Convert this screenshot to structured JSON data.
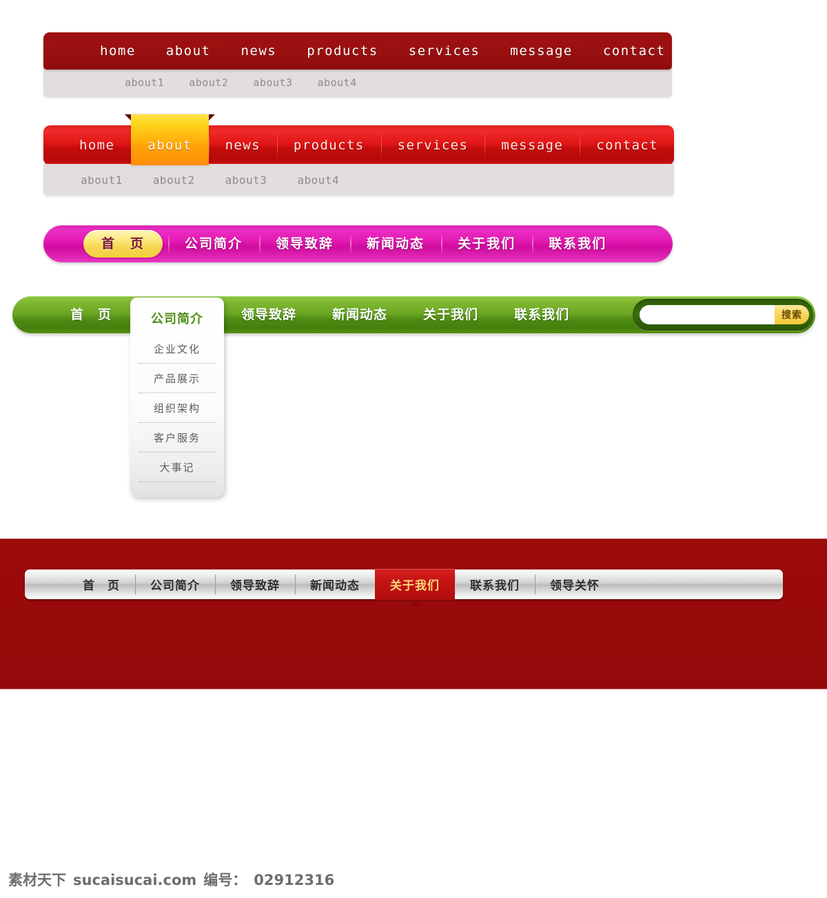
{
  "nav_red_flat": {
    "items": [
      "home",
      "about",
      "news",
      "products",
      "services",
      "message",
      "contact"
    ],
    "sub_items": [
      "about1",
      "about2",
      "about3",
      "about4"
    ],
    "bar_color": "#991010",
    "sub_color": "#e2dedd"
  },
  "nav_red_glossy": {
    "items": [
      "home",
      "about",
      "news",
      "products",
      "services",
      "message",
      "contact"
    ],
    "active_item": "about",
    "sub_items": [
      "about1",
      "about2",
      "about3",
      "about4"
    ],
    "bar_color": "#e01515",
    "active_color": "#ffa408",
    "sub_color": "#e2dedd"
  },
  "nav_magenta": {
    "items": [
      "首　页",
      "公司简介",
      "领导致辞",
      "新闻动态",
      "关于我们",
      "联系我们"
    ],
    "active_item": "首　页",
    "bar_color": "#e61bb5",
    "active_color": "#f6d752",
    "active_text_color": "#7a1530"
  },
  "nav_green": {
    "items": [
      "首　页",
      "公司简介",
      "领导致辞",
      "新闻动态",
      "关于我们",
      "联系我们"
    ],
    "active_item": "公司简介",
    "bar_color": "#6aa522",
    "search": {
      "value": "",
      "placeholder": "",
      "button_label": "搜索",
      "button_color": "#f3c63c"
    },
    "dropdown": {
      "header": "公司简介",
      "items": [
        "企业文化",
        "产品展示",
        "组织架构",
        "客户服务",
        "大事记"
      ],
      "header_color": "#4e8d12"
    }
  },
  "nav_silver": {
    "items": [
      "首　页",
      "公司简介",
      "领导致辞",
      "新闻动态",
      "关于我们",
      "联系我们",
      "领导关怀"
    ],
    "active_item": "关于我们",
    "block_color": "#980a0a",
    "bar_color": "#d3d3d3",
    "active_color": "#c41313",
    "active_text_color": "#ffd77a"
  },
  "footer": {
    "site_cn": "素材天下",
    "site_domain": "sucaisucai.com",
    "id_label": "编号：",
    "id_value": "02912316"
  }
}
